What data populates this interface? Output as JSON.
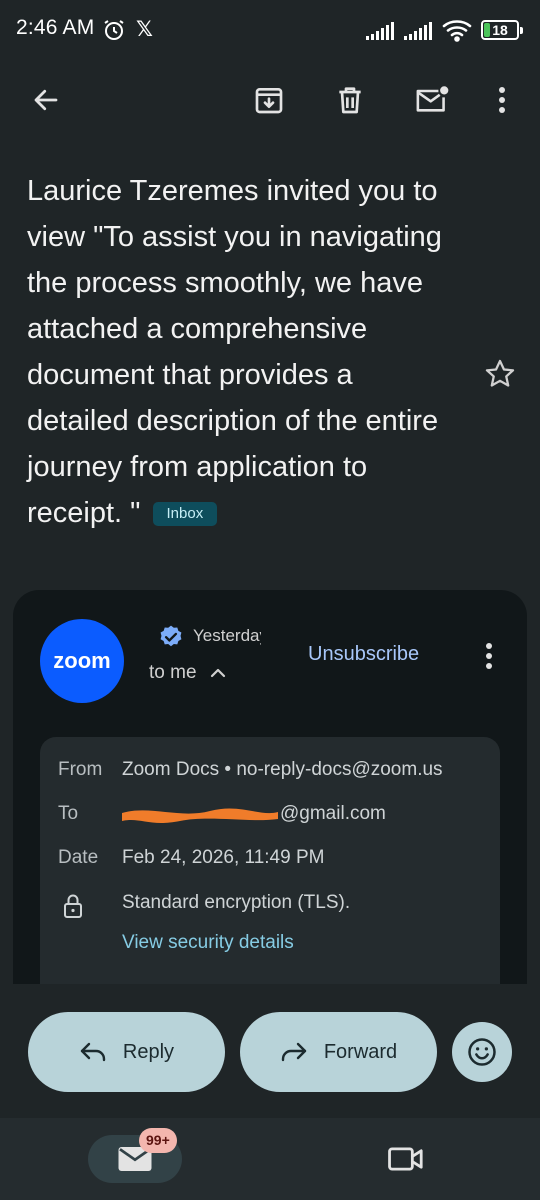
{
  "status_bar": {
    "time": "2:46 AM",
    "battery": "18",
    "battery_fraction": 0.18,
    "icons": [
      "alarm-icon",
      "x-logo-icon",
      "signal-icon",
      "signal-icon",
      "wifi-icon",
      "battery-icon"
    ]
  },
  "toolbar": {
    "icons": [
      "back-arrow-icon",
      "archive-icon",
      "delete-icon",
      "mark-unread-icon",
      "more-vert-icon"
    ]
  },
  "subject": {
    "text": "Laurice Tzeremes invited you to view \"To assist you in navigating the process smoothly, we have attached a comprehensive document that provides a detailed description of the entire journey from application to receipt. \"",
    "label": "Inbox"
  },
  "message": {
    "avatar_text": "zoom",
    "time": "Yesterday",
    "recipient_summary": "to me",
    "unsubscribe_label": "Unsubscribe",
    "details": {
      "from_label": "From",
      "from_value": "Zoom Docs • no-reply-docs@zoom.us",
      "to_label": "To",
      "to_value": "@gmail.com",
      "date_label": "Date",
      "date_value": "Feb 24, 2026, 11:49 PM",
      "encryption": "Standard encryption (TLS).",
      "security_link": "View security details"
    }
  },
  "actions": {
    "reply_label": "Reply",
    "forward_label": "Forward"
  },
  "bottom_nav": {
    "mail_badge": "99+"
  },
  "colors": {
    "background": "#1f2527",
    "card": "#111719",
    "zoom_blue": "#0b5cff",
    "link": "#86cce4",
    "unsubscribe": "#a8c7fa",
    "action_button": "#b8d3d9",
    "badge": "#f3b6ae"
  }
}
